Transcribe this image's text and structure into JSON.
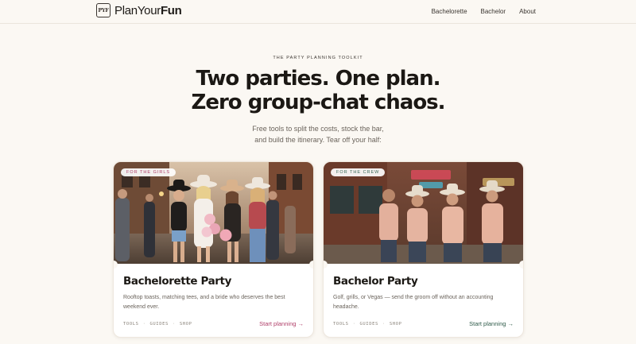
{
  "nav": {
    "logo_mark": "PYF",
    "logo_light": "PlanYour",
    "logo_bold": "Fun",
    "links": [
      "Bachelorette",
      "Bachelor",
      "About"
    ]
  },
  "hero": {
    "eyebrow": "THE PARTY PLANNING TOOLKIT",
    "headline_line1": "Two parties. One plan.",
    "headline_line2": "Zero group-chat chaos.",
    "sub_line1": "Free tools to split the costs, stock the bar,",
    "sub_line2": "and build the itinerary. Tear off your half:"
  },
  "cards": [
    {
      "tag": "FOR THE GIRLS",
      "title": "Bachelorette Party",
      "desc": "Rooftop toasts, matching tees, and a bride who deserves the best weekend ever.",
      "links": [
        "TOOLS",
        "GUIDES",
        "SHOP"
      ],
      "cta": "Start planning →",
      "accent": "#b0406a"
    },
    {
      "tag": "FOR THE CREW",
      "title": "Bachelor Party",
      "desc": "Golf, grills, or Vegas — send the groom off without an accounting headache.",
      "links": [
        "TOOLS",
        "GUIDES",
        "SHOP"
      ],
      "cta": "Start planning →",
      "accent": "#2f5b4a"
    }
  ]
}
